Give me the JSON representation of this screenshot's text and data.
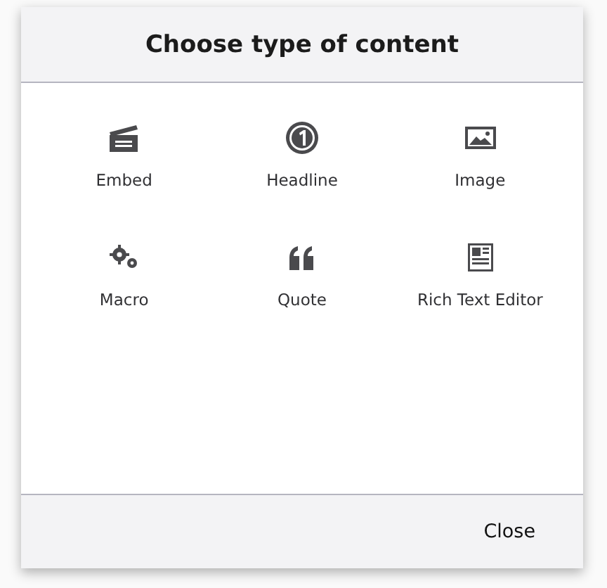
{
  "dialog": {
    "title": "Choose type of content",
    "items": [
      {
        "kind": "embed",
        "label": "Embed"
      },
      {
        "kind": "headline",
        "label": "Headline"
      },
      {
        "kind": "image",
        "label": "Image"
      },
      {
        "kind": "macro",
        "label": "Macro"
      },
      {
        "kind": "quote",
        "label": "Quote"
      },
      {
        "kind": "rte",
        "label": "Rich Text Editor"
      }
    ],
    "buttons": [
      "Close"
    ]
  }
}
